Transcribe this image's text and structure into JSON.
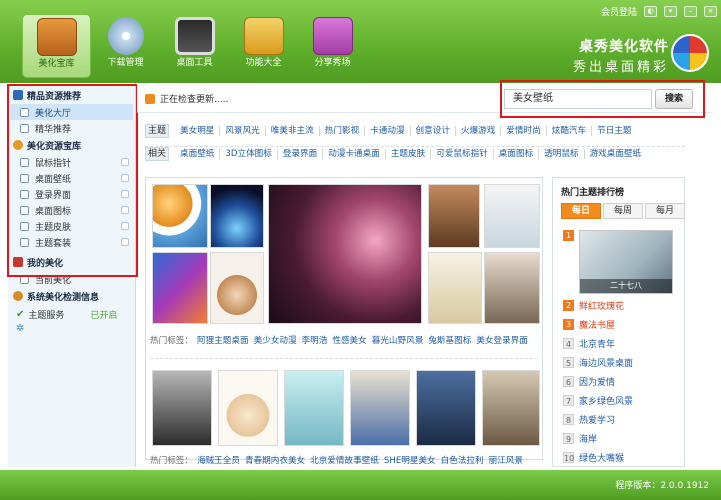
{
  "topbar": {
    "login": "会员登陆",
    "nav": [
      {
        "label": "美化宝库",
        "icon": "treasure-box-icon"
      },
      {
        "label": "下载管理",
        "icon": "download-disc-icon"
      },
      {
        "label": "桌面工具",
        "icon": "desktop-screen-icon"
      },
      {
        "label": "功能大全",
        "icon": "toolbox-icon"
      },
      {
        "label": "分享秀场",
        "icon": "share-icon"
      }
    ],
    "brand_title": "桌秀美化软件",
    "brand_slogan": "秀出桌面精彩"
  },
  "sidebar": {
    "group1": "精品资源推荐",
    "items1": [
      {
        "label": "美化大厅"
      },
      {
        "label": "精华推荐"
      }
    ],
    "group2": "美化资源宝库",
    "items2": [
      {
        "label": "鼠标指针"
      },
      {
        "label": "桌面壁纸"
      },
      {
        "label": "登录界面"
      },
      {
        "label": "桌面图标"
      },
      {
        "label": "主题皮肤"
      },
      {
        "label": "主题套装"
      }
    ],
    "group3": "我的美化",
    "items3": [
      {
        "label": "当前美化"
      }
    ],
    "group4": "系统美化检测信息",
    "service": {
      "label": "主题服务",
      "status": "已开启"
    }
  },
  "status": {
    "text": "正在检查更新....."
  },
  "search": {
    "value": "美女壁纸",
    "button": "搜索"
  },
  "tags": {
    "topic_label": "主题",
    "topic": [
      "美女明星",
      "风景风光",
      "唯美非主流",
      "热门影视",
      "卡通动漫",
      "创意设计",
      "火爆游戏",
      "爱情时尚",
      "炫酷汽车",
      "节日主题"
    ],
    "related_label": "相关",
    "related": [
      "桌面壁纸",
      "3D立体图标",
      "登录界面",
      "动漫卡通桌面",
      "主题皮肤",
      "可爱鼠标指针",
      "桌面图标",
      "透明鼠标",
      "游戏桌面壁纸"
    ]
  },
  "gallery": {
    "hot_label": "热门标签：",
    "hot1": [
      "阿狸主题桌面",
      "美少女动漫",
      "李明浩",
      "性感美女",
      "暮光山野风景",
      "兔斯基图标",
      "美女登录界面"
    ],
    "hot2": [
      "海贼王全员",
      "青春期内衣美女",
      "北京爱情故事壁纸",
      "SHE明星美女",
      "白色法拉利",
      "丽江风景"
    ]
  },
  "ranking": {
    "title": "热门主题排行榜",
    "tabs": [
      "每日",
      "每周",
      "每月"
    ],
    "thumb_caption": "二十七八",
    "items": [
      {
        "num": "1",
        "text": ""
      },
      {
        "num": "2",
        "text": "鲜红玫瑰花"
      },
      {
        "num": "3",
        "text": "魔法书屋"
      },
      {
        "num": "4",
        "text": "北京青年"
      },
      {
        "num": "5",
        "text": "海边风景桌面"
      },
      {
        "num": "6",
        "text": "因为爱情"
      },
      {
        "num": "7",
        "text": "家乡绿色风景"
      },
      {
        "num": "8",
        "text": "热爱学习"
      },
      {
        "num": "9",
        "text": "海岸"
      },
      {
        "num": "10",
        "text": "绿色大嘴猴"
      }
    ]
  },
  "footer": {
    "version": "程序版本：2.0.0.1912"
  }
}
